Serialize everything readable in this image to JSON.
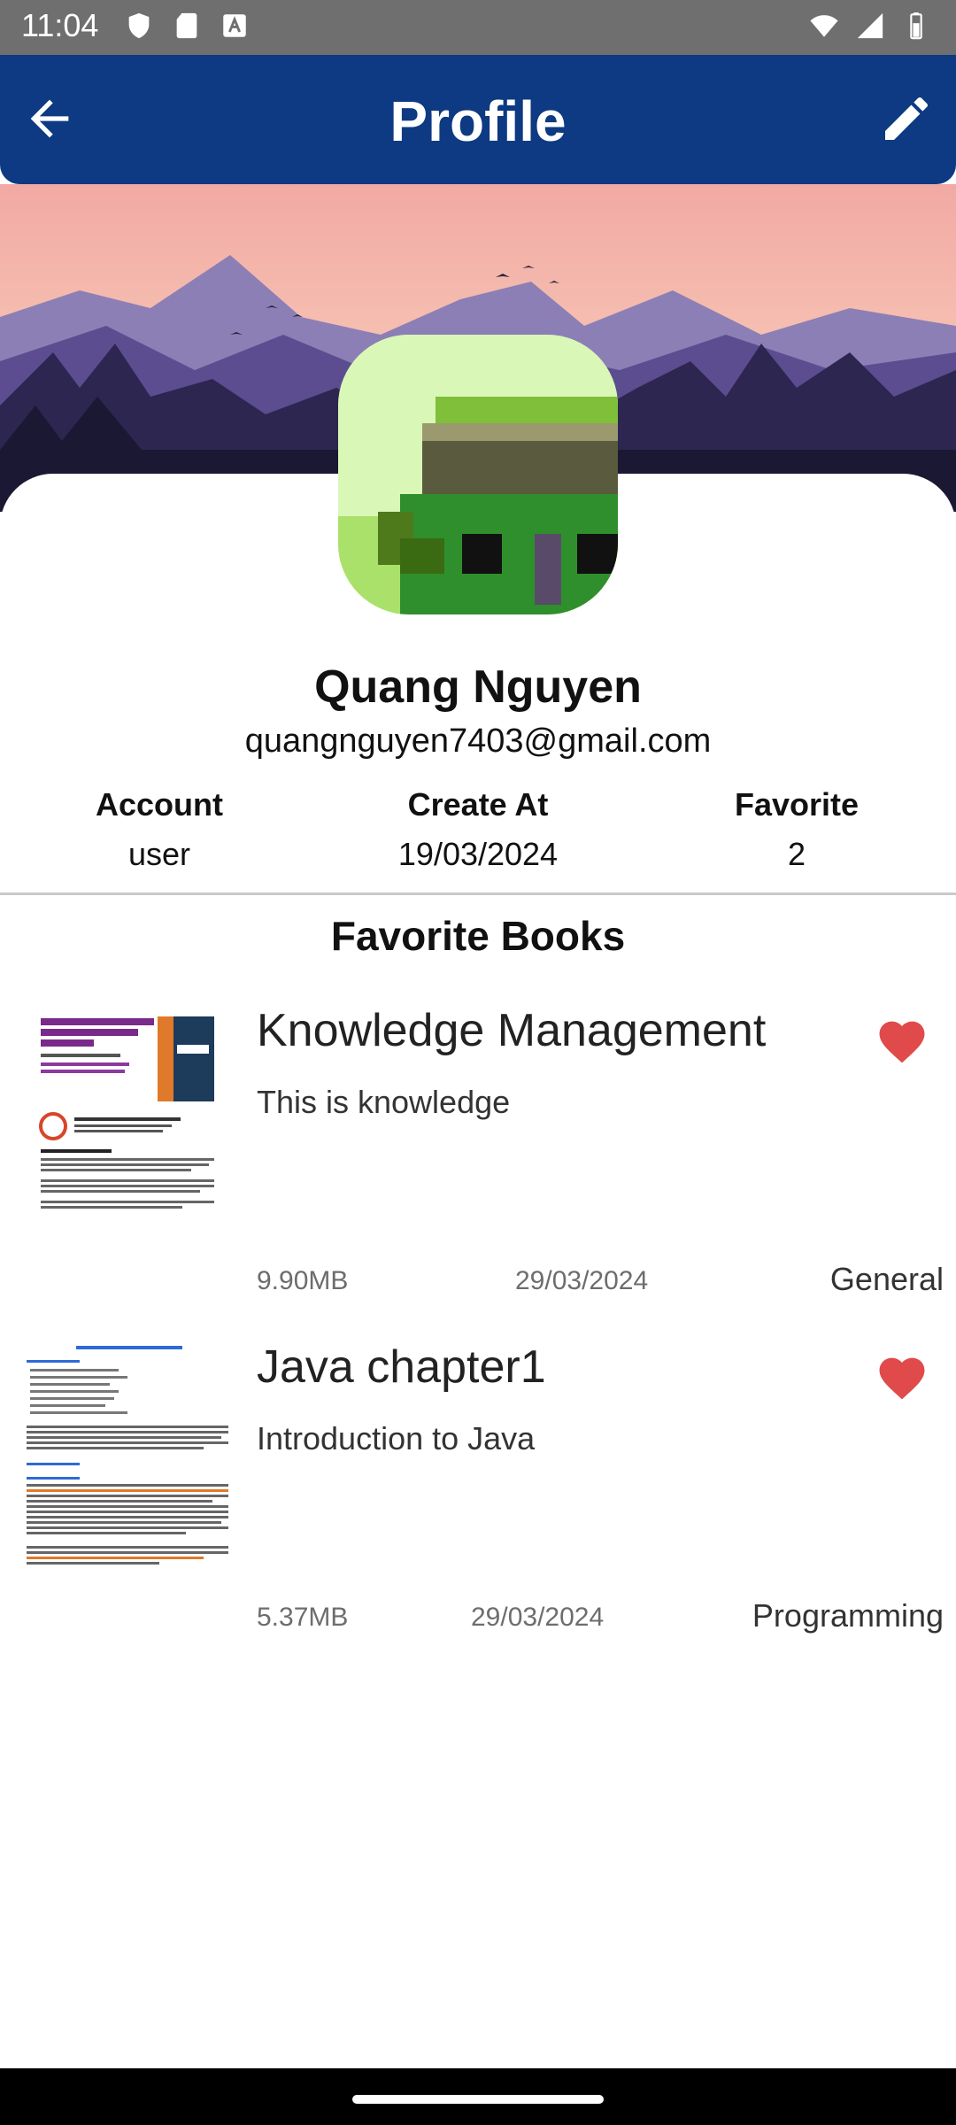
{
  "status_bar": {
    "time": "11:04"
  },
  "app_bar": {
    "title": "Profile"
  },
  "profile": {
    "name": "Quang Nguyen",
    "email": "quangnguyen7403@gmail.com",
    "stats": [
      {
        "label": "Account",
        "value": "user"
      },
      {
        "label": "Create At",
        "value": "19/03/2024"
      },
      {
        "label": "Favorite",
        "value": "2"
      }
    ]
  },
  "favorites": {
    "section_title": "Favorite Books",
    "books": [
      {
        "title": "Knowledge Management",
        "description": "This is knowledge",
        "size": "9.90MB",
        "date": "29/03/2024",
        "category": "General",
        "favorite": true
      },
      {
        "title": "Java chapter1",
        "description": "Introduction to Java",
        "size": "5.37MB",
        "date": "29/03/2024",
        "category": "Programming",
        "favorite": true
      }
    ]
  },
  "colors": {
    "app_bar": "#0d3a82",
    "heart": "#e04a4a"
  }
}
